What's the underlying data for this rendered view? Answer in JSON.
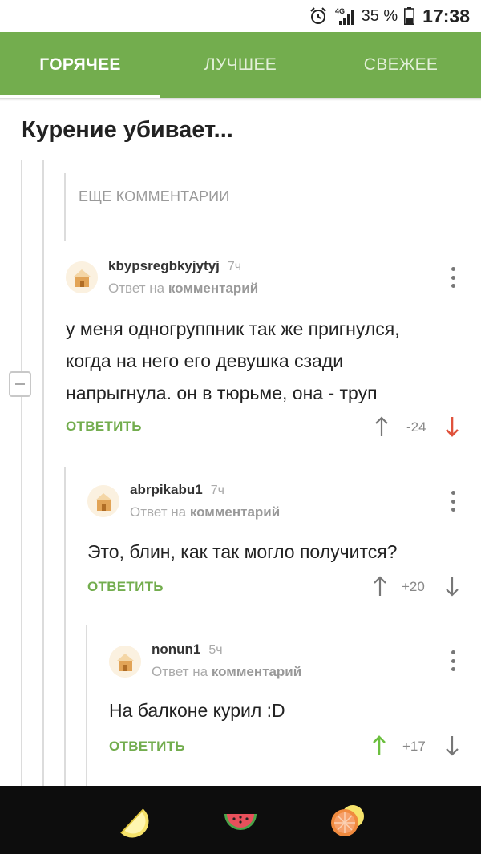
{
  "status_bar": {
    "network": "4G",
    "battery_percent": "35 %",
    "time": "17:38",
    "icons": [
      "alarm-clock-icon",
      "signal-icon",
      "battery-icon"
    ]
  },
  "tabs": [
    {
      "label": "ГОРЯЧЕЕ",
      "active": true
    },
    {
      "label": "ЛУЧШЕЕ",
      "active": false
    },
    {
      "label": "СВЕЖЕЕ",
      "active": false
    }
  ],
  "post": {
    "title": "Курение убивает..."
  },
  "more_comments_label": "ЕЩЕ КОММЕНТАРИИ",
  "comments": [
    {
      "author": "kbypsregbkyjytyj",
      "time": "7ч",
      "reply_prefix": "Ответ на",
      "reply_target": "комментарий",
      "lines": [
        "у меня одногруппник так же пригнулся,",
        "когда на него его девушка сзади",
        "напрыгнула. он в тюрьме, она - труп"
      ],
      "reply_label": "ОТВЕТИТЬ",
      "rating": "-24",
      "vote": "down"
    },
    {
      "author": "abrpikabu1",
      "time": "7ч",
      "reply_prefix": "Ответ на",
      "reply_target": "комментарий",
      "lines": [
        "Это, блин, как так могло получится?"
      ],
      "reply_label": "ОТВЕТИТЬ",
      "rating": "+20",
      "vote": "none"
    },
    {
      "author": "nonun1",
      "time": "5ч",
      "reply_prefix": "Ответ на",
      "reply_target": "комментарий",
      "lines": [
        "На балконе курил :D"
      ],
      "reply_label": "ОТВЕТИТЬ",
      "rating": "+17",
      "vote": "up"
    }
  ],
  "colors": {
    "accent_green": "#73ad4e",
    "downvote_red": "#e0523c",
    "upvote_green": "#6cbf3f"
  },
  "bottom_nav": [
    "lemon-icon",
    "watermelon-icon",
    "grapefruit-icon"
  ]
}
